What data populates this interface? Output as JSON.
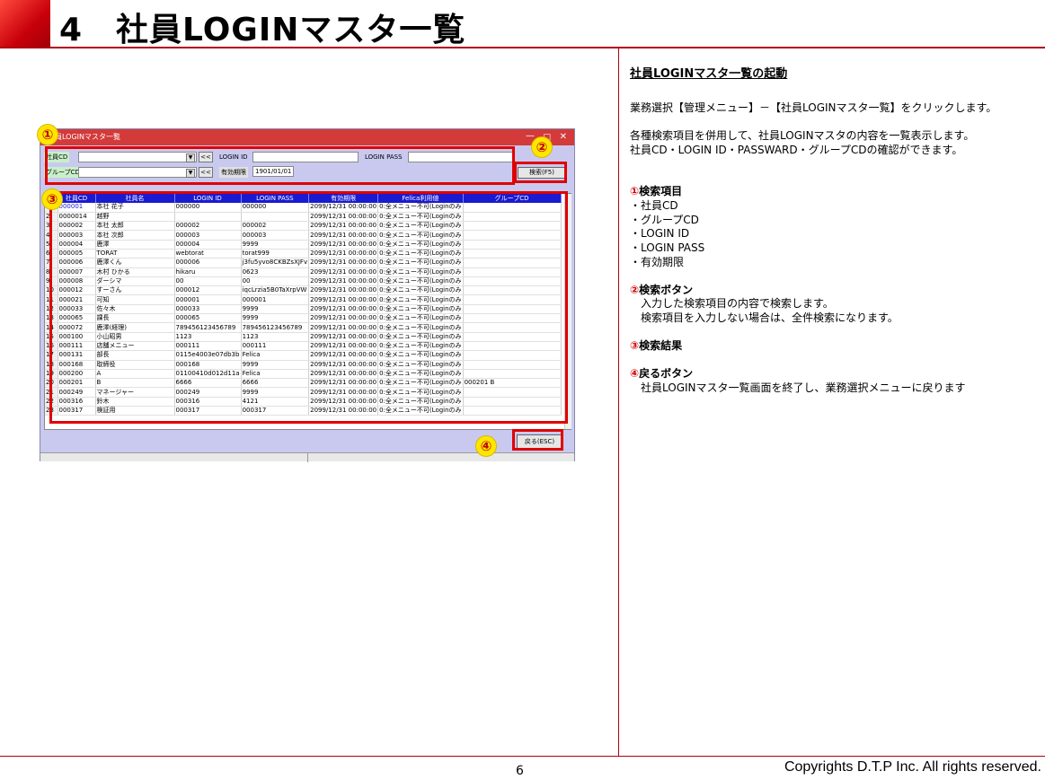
{
  "header": {
    "title": "4　社員LOGINマスタ一覧"
  },
  "footer": {
    "page": "6",
    "copyright": "Copyrights  D.T.P Inc. All rights reserved."
  },
  "window": {
    "title": "員LOGINマスタ一覧",
    "labels": {
      "emp_cd": "社員CD",
      "login_id": "LOGIN ID",
      "login_pass": "LOGIN PASS",
      "group_cd": "グループCD",
      "expiry": "有効期限"
    },
    "expiry_value": "1901/01/01",
    "prev_button": "<<",
    "search_button": "検索(F5)",
    "back_button": "戻る(ESC)",
    "columns": [
      "",
      "社員CD",
      "社員名",
      "LOGIN ID",
      "LOGIN PASS",
      "有効期限",
      "Felica利用値",
      "グループCD"
    ],
    "rows": [
      [
        "1",
        "000001",
        "本社 花子",
        "000000",
        "000000",
        "2099/12/31 00:00:00",
        "0:全メニュー不可(Loginのみ",
        ""
      ],
      [
        "2",
        "0000014",
        "越野",
        "",
        "",
        "2099/12/31 00:00:00",
        "0:全メニュー不可(Loginのみ",
        ""
      ],
      [
        "3",
        "000002",
        "本社 太郎",
        "000002",
        "000002",
        "2099/12/31 00:00:00",
        "0:全メニュー不可(Loginのみ",
        ""
      ],
      [
        "4",
        "000003",
        "本社 次郎",
        "000003",
        "000003",
        "2099/12/31 00:00:00",
        "0:全メニュー不可(Loginのみ",
        ""
      ],
      [
        "5",
        "000004",
        "鹿澤",
        "000004",
        "9999",
        "2099/12/31 00:00:00",
        "0:全メニュー不可(Loginのみ",
        ""
      ],
      [
        "6",
        "000005",
        "TORAT",
        "webtorat",
        "torat999",
        "2099/12/31 00:00:00",
        "0:全メニュー不可(Loginのみ",
        ""
      ],
      [
        "7",
        "000006",
        "鹿澤くん",
        "000006",
        "j3fu5yvo8CKBZsXJFv",
        "2099/12/31 00:00:00",
        "0:全メニュー不可(Loginのみ",
        ""
      ],
      [
        "8",
        "000007",
        "木村 ひかる",
        "hikaru",
        "0623",
        "2099/12/31 00:00:00",
        "0:全メニュー不可(Loginのみ",
        ""
      ],
      [
        "9",
        "000008",
        "ダーシマ",
        "00",
        "00",
        "2099/12/31 00:00:00",
        "0:全メニュー不可(Loginのみ",
        ""
      ],
      [
        "10",
        "000012",
        "すーさん",
        "000012",
        "iqcLrzia5B0TaXrpVW",
        "2099/12/31 00:00:00",
        "0:全メニュー不可(Loginのみ",
        ""
      ],
      [
        "11",
        "000021",
        "可知",
        "000001",
        "000001",
        "2099/12/31 00:00:00",
        "0:全メニュー不可(Loginのみ",
        ""
      ],
      [
        "12",
        "000033",
        "佐々木",
        "000033",
        "9999",
        "2099/12/31 00:00:00",
        "0:全メニュー不可(Loginのみ",
        ""
      ],
      [
        "13",
        "000065",
        "課長",
        "000065",
        "9999",
        "2099/12/31 00:00:00",
        "0:全メニュー不可(Loginのみ",
        ""
      ],
      [
        "14",
        "000072",
        "鹿澤(経理)",
        "789456123456789",
        "789456123456789",
        "2099/12/31 00:00:00",
        "0:全メニュー不可(Loginのみ",
        ""
      ],
      [
        "15",
        "000100",
        "小山昭男",
        "1123",
        "1123",
        "2099/12/31 00:00:00",
        "0:全メニュー不可(Loginのみ",
        ""
      ],
      [
        "16",
        "000111",
        "店舗メニュー",
        "000111",
        "000111",
        "2099/12/31 00:00:00",
        "0:全メニュー不可(Loginのみ",
        ""
      ],
      [
        "17",
        "000131",
        "部長",
        "0115e4003e07db3b",
        "Felica",
        "2099/12/31 00:00:00",
        "0:全メニュー不可(Loginのみ",
        ""
      ],
      [
        "18",
        "000168",
        "取締役",
        "000168",
        "9999",
        "2099/12/31 00:00:00",
        "0:全メニュー不可(Loginのみ",
        ""
      ],
      [
        "19",
        "000200",
        "A",
        "01100410d012d11a",
        "Felica",
        "2099/12/31 00:00:00",
        "0:全メニュー不可(Loginのみ",
        ""
      ],
      [
        "20",
        "000201",
        "B",
        "6666",
        "6666",
        "2099/12/31 00:00:00",
        "0:全メニュー不可(Loginのみ",
        "000201 B"
      ],
      [
        "21",
        "000249",
        "マネージャー",
        "000249",
        "9999",
        "2099/12/31 00:00:00",
        "0:全メニュー不可(Loginのみ",
        ""
      ],
      [
        "22",
        "000316",
        "鈴木",
        "000316",
        "4121",
        "2099/12/31 00:00:00",
        "0:全メニュー不可(Loginのみ",
        ""
      ],
      [
        "23",
        "000317",
        "検証用",
        "000317",
        "000317",
        "2099/12/31 00:00:00",
        "0:全メニュー不可(Loginのみ",
        ""
      ]
    ]
  },
  "callouts": {
    "c1": "①",
    "c2": "②",
    "c3": "③",
    "c4": "④"
  },
  "colors": {
    "accent": "#c8000a",
    "grid_header": "#1a1ad0",
    "window_bg": "#c9c9f0",
    "callout_box": "#e00000",
    "badge": "#ffe600"
  },
  "explanation": {
    "title": "社員LOGINマスタ一覧の起動",
    "intro": "業務選択【管理メニュー】－【社員LOGINマスタ一覧】をクリックします。",
    "desc1": "各種検索項目を併用して、社員LOGINマスタの内容を一覧表示します。",
    "desc2": "社員CD・LOGIN ID・PASSWARD・グループCDの確認ができます。",
    "s1_num": "①",
    "s1_title": "検索項目",
    "s1_items": [
      "・社員CD",
      "・グループCD",
      "・LOGIN ID",
      "・LOGIN PASS",
      "・有効期限"
    ],
    "s2_num": "②",
    "s2_title": "検索ボタン",
    "s2_line1": "入力した検索項目の内容で検索します。",
    "s2_line2": "検索項目を入力しない場合は、全件検索になります。",
    "s3_num": "③",
    "s3_title": "検索結果",
    "s4_num": "④",
    "s4_title": "戻るボタン",
    "s4_line1": "社員LOGINマスタ一覧画面を終了し、業務選択メニューに戻ります"
  }
}
